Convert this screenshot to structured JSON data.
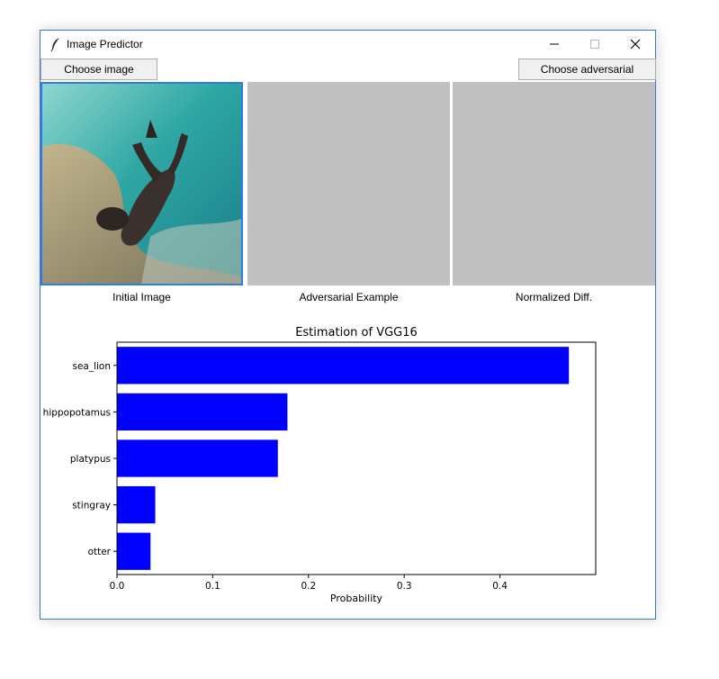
{
  "window": {
    "title": "Image Predictor",
    "icon": "feather-icon"
  },
  "toolbar": {
    "choose_image_label": "Choose image",
    "choose_adversarial_label": "Choose adversarial"
  },
  "panels": {
    "initial_caption": "Initial Image",
    "adversarial_caption": "Adversarial Example",
    "diff_caption": "Normalized Diff."
  },
  "chart_data": {
    "type": "bar",
    "orientation": "horizontal",
    "title": "Estimation of VGG16",
    "xlabel": "Probability",
    "ylabel": "",
    "categories": [
      "sea_lion",
      "hippopotamus",
      "platypus",
      "stingray",
      "otter"
    ],
    "values": [
      0.472,
      0.178,
      0.168,
      0.04,
      0.035
    ],
    "xlim": [
      0.0,
      0.5
    ],
    "xticks": [
      "0.0",
      "0.1",
      "0.2",
      "0.3",
      "0.4"
    ],
    "bar_color": "#0000ff",
    "grid": false
  }
}
